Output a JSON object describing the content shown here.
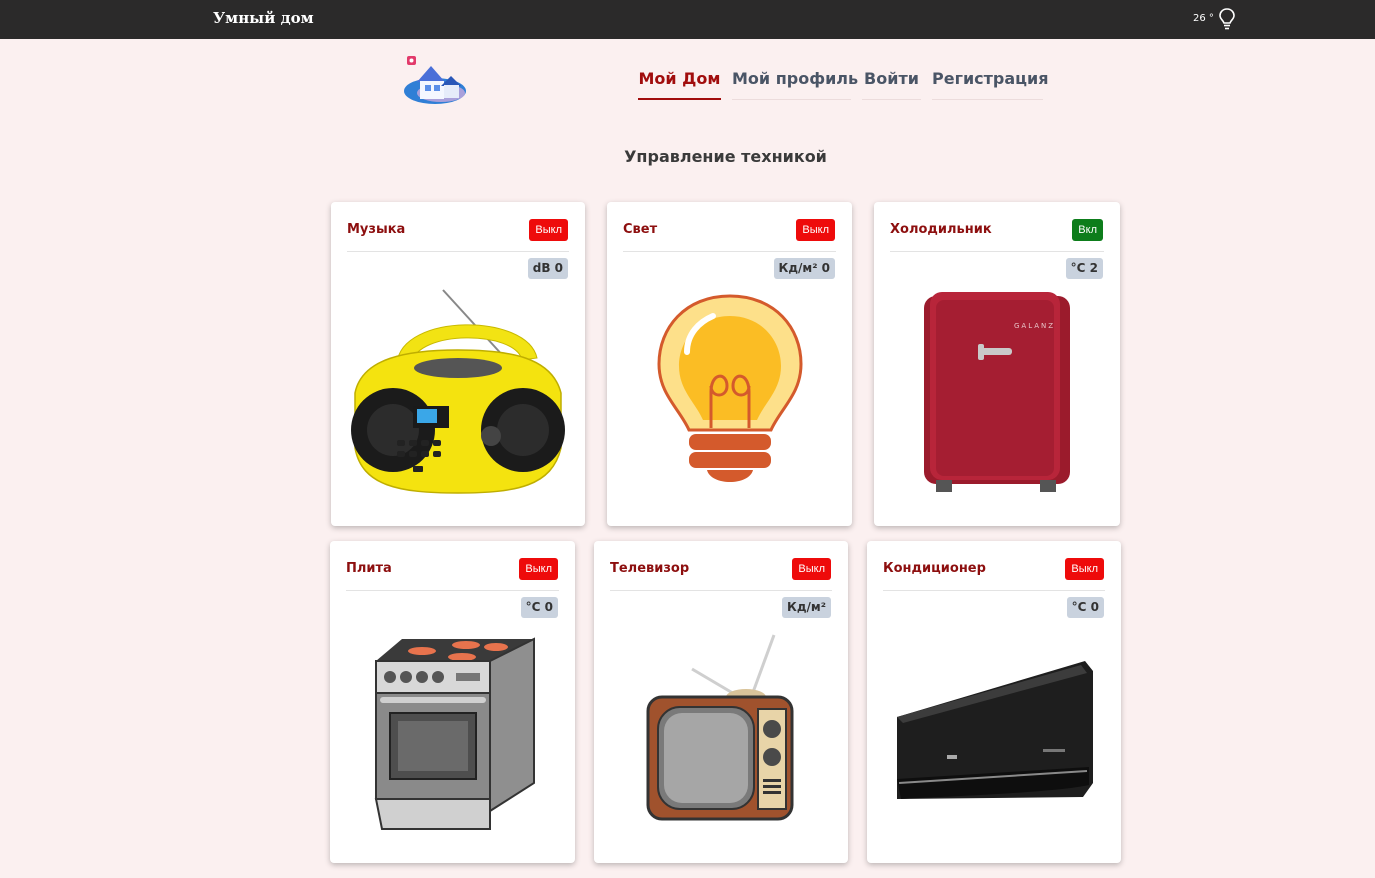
{
  "header": {
    "brand": "Умный дом",
    "temperature": "26 °"
  },
  "nav": [
    {
      "label": "Мой Дом",
      "active": true
    },
    {
      "label": "Мой профиль",
      "active": false
    },
    {
      "label": "Войти",
      "active": false
    },
    {
      "label": "Регистрация",
      "active": false
    }
  ],
  "page": {
    "title": "Управление техникой"
  },
  "colors": {
    "accent": "#a10d0d",
    "off": "#ee0b0b",
    "on": "#0d7d1b",
    "topbar": "#2b2a2a",
    "background": "#fbf0f0"
  },
  "devices": [
    {
      "name": "Музыка",
      "state": "Выкл",
      "on": false,
      "reading": "dB 0",
      "icon": "boombox-icon"
    },
    {
      "name": "Свет",
      "state": "Выкл",
      "on": false,
      "reading": "Кд/м² 0",
      "icon": "light-bulb-icon"
    },
    {
      "name": "Холодильник",
      "state": "Вкл",
      "on": true,
      "reading": "°C 2",
      "icon": "fridge-icon"
    },
    {
      "name": "Плита",
      "state": "Выкл",
      "on": false,
      "reading": "°C 0",
      "icon": "stove-icon"
    },
    {
      "name": "Телевизор",
      "state": "Выкл",
      "on": false,
      "reading": "Кд/м²",
      "icon": "tv-icon"
    },
    {
      "name": "Кондиционер",
      "state": "Выкл",
      "on": false,
      "reading": "°C 0",
      "icon": "air-conditioner-icon"
    }
  ]
}
